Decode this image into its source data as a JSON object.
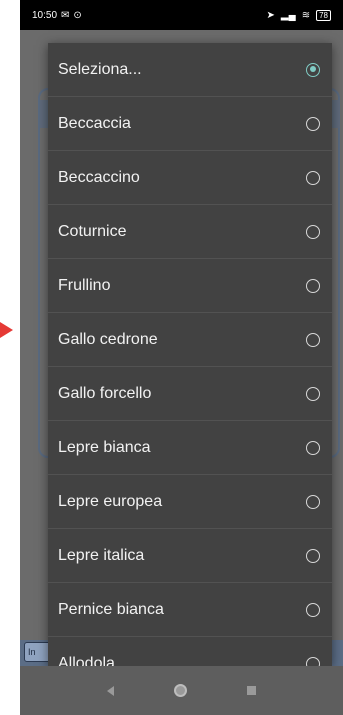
{
  "status_bar": {
    "time": "10:50",
    "battery": "78"
  },
  "background": {
    "bottom_tag": "In"
  },
  "dropdown": {
    "options": [
      {
        "label": "Seleziona...",
        "selected": true
      },
      {
        "label": "Beccaccia",
        "selected": false
      },
      {
        "label": "Beccaccino",
        "selected": false
      },
      {
        "label": "Coturnice",
        "selected": false
      },
      {
        "label": "Frullino",
        "selected": false
      },
      {
        "label": "Gallo cedrone",
        "selected": false
      },
      {
        "label": "Gallo forcello",
        "selected": false
      },
      {
        "label": "Lepre bianca",
        "selected": false
      },
      {
        "label": "Lepre europea",
        "selected": false
      },
      {
        "label": "Lepre italica",
        "selected": false
      },
      {
        "label": "Pernice bianca",
        "selected": false
      },
      {
        "label": "Allodola",
        "selected": false
      }
    ],
    "accent_color": "#80cbc4"
  },
  "nav_bar": {
    "icons": [
      "back-icon",
      "home-icon",
      "recents-icon"
    ]
  }
}
